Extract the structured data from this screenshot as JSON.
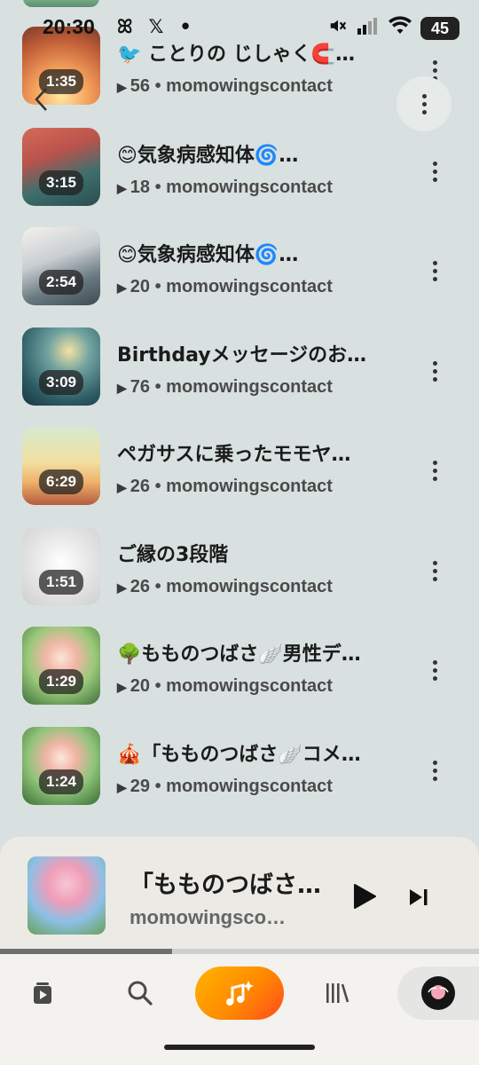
{
  "status_bar": {
    "time": "20:30",
    "left_icons": [
      "butterfly-icon",
      "x-logo-icon",
      "dot-icon"
    ],
    "right_icons": [
      "mute-icon",
      "signal-icon",
      "wifi-icon"
    ],
    "battery": "45"
  },
  "songs": [
    {
      "title": "🐦 ことりの じしゃく🧲…",
      "duration": "1:35",
      "plays": "56",
      "artist": "momowingscontact"
    },
    {
      "title": "😊気象病感知体🌀…",
      "duration": "3:15",
      "plays": "18",
      "artist": "momowingscontact"
    },
    {
      "title": "😊気象病感知体🌀…",
      "duration": "2:54",
      "plays": "20",
      "artist": "momowingscontact"
    },
    {
      "title": "Birthdayメッセージのお…",
      "duration": "3:09",
      "plays": "76",
      "artist": "momowingscontact"
    },
    {
      "title": "ペガサスに乗ったモモヤ…",
      "duration": "6:29",
      "plays": "26",
      "artist": "momowingscontact"
    },
    {
      "title": "ご縁の3段階",
      "duration": "1:51",
      "plays": "26",
      "artist": "momowingscontact"
    },
    {
      "title": "🌳もものつばさ🪽男性デ…",
      "duration": "1:29",
      "plays": "20",
      "artist": "momowingscontact"
    },
    {
      "title": "🎪「もものつばさ🪽コメ…",
      "duration": "1:24",
      "plays": "29",
      "artist": "momowingscontact"
    }
  ],
  "meta_separator": "•",
  "now_playing": {
    "title": "「もものつばさ…",
    "artist": "momowingsco…",
    "progress": 0.36
  },
  "nav": {
    "items": [
      "home-icon",
      "search-icon",
      "create-icon",
      "library-icon",
      "profile-avatar"
    ],
    "active": "create-icon",
    "accent_color": "#ff8a00"
  }
}
